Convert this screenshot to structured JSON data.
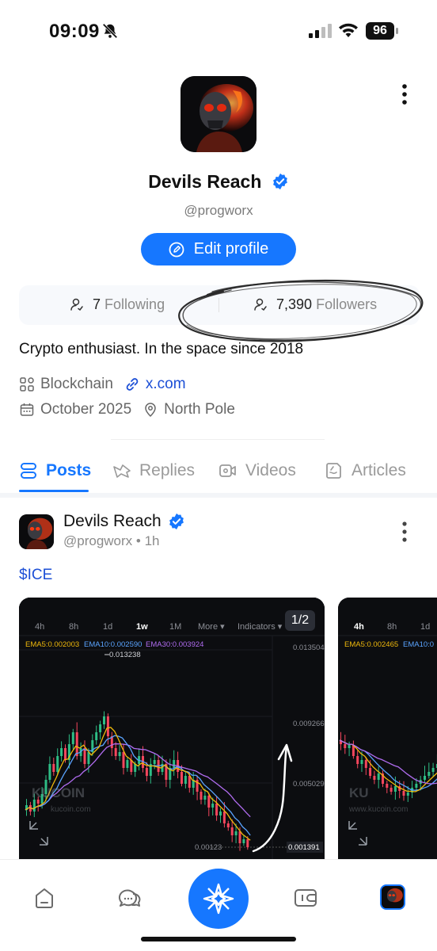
{
  "status_bar": {
    "time": "09:09",
    "battery": "96"
  },
  "profile": {
    "name": "Devils Reach",
    "handle": "@progworx",
    "edit_label": "Edit profile",
    "following_count": "7",
    "following_label": "Following",
    "followers_count": "7,390",
    "followers_label": "Followers",
    "bio": "Crypto enthusiast. In the space since 2018",
    "category": "Blockchain",
    "link": "x.com",
    "joined": "October 2025",
    "location": "North Pole"
  },
  "tabs": [
    {
      "label": "Posts",
      "icon": "posts-icon"
    },
    {
      "label": "Replies",
      "icon": "replies-icon"
    },
    {
      "label": "Videos",
      "icon": "videos-icon"
    },
    {
      "label": "Articles",
      "icon": "articles-icon"
    }
  ],
  "post": {
    "author": "Devils Reach",
    "handle": "@progworx",
    "time": "• 1h",
    "ticker": "$ICE",
    "image_counter": "1/2",
    "chart1": {
      "timeframes": [
        "4h",
        "8h",
        "1d",
        "1w",
        "1M",
        "More ▾",
        "Indicators ▾"
      ],
      "active_timeframe": "1w",
      "ema5": "EMA5:0.002003",
      "ema10": "EMA10:0.002590",
      "ema30": "EMA30:0.003924",
      "high_label": "0.013238",
      "axis": [
        "0.013504",
        "0.009266",
        "0.005029",
        "0.001391"
      ],
      "last_price": "0.001391",
      "low_label": "0.00123",
      "watermark": "KUCOIN",
      "watermark_url": "kucoin.com"
    },
    "chart2": {
      "timeframes": [
        "4h",
        "8h",
        "1d"
      ],
      "active_timeframe": "4h",
      "ema5": "EMA5:0.002465",
      "ema10": "EMA10:0",
      "watermark": "KU",
      "watermark_url": "www.kucoin.com"
    }
  },
  "colors": {
    "accent": "#1677ff",
    "link": "#1c4fd6",
    "candle_up": "#2ebd85",
    "candle_down": "#f6465d",
    "ema5": "#f0b90b",
    "ema10": "#5aa4ff",
    "ema30": "#b06cf0"
  },
  "bottom_nav": [
    "home-icon",
    "chat-icon",
    "kucoin-star-icon",
    "wallet-icon",
    "profile-avatar"
  ]
}
